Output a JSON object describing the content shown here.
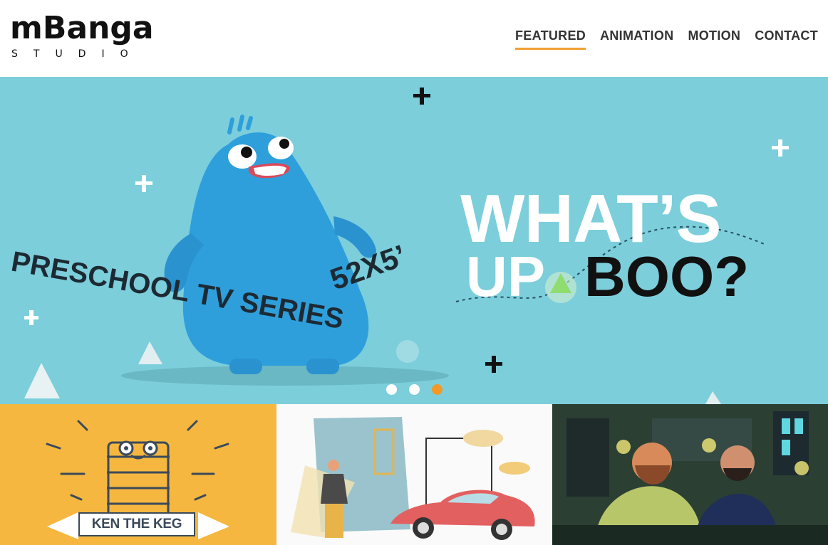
{
  "header": {
    "logo_main": "mBanga",
    "logo_sub": "STUDIO",
    "nav": [
      {
        "label": "FEATURED",
        "active": true
      },
      {
        "label": "ANIMATION",
        "active": false
      },
      {
        "label": "MOTION",
        "active": false
      },
      {
        "label": "CONTACT",
        "active": false
      }
    ]
  },
  "hero": {
    "slide_text_1": "PRESCHOOL TV SERIES",
    "slide_text_2": "52X5’",
    "title_line1": "WHAT’S",
    "title_line2_a": "UP",
    "title_line2_b": "BOO?",
    "background_color": "#7ccedb",
    "slider_dots": [
      {
        "active": false
      },
      {
        "active": false
      },
      {
        "active": true
      }
    ],
    "accent_color": "#f19a28"
  },
  "tiles": [
    {
      "name": "ken-the-keg",
      "label": "KEN THE KEG",
      "color": "#f6b740"
    },
    {
      "name": "vintage-car-illustration",
      "color": "#fafafa"
    },
    {
      "name": "bar-scene-illustration",
      "color": "#2f4a3a"
    }
  ]
}
